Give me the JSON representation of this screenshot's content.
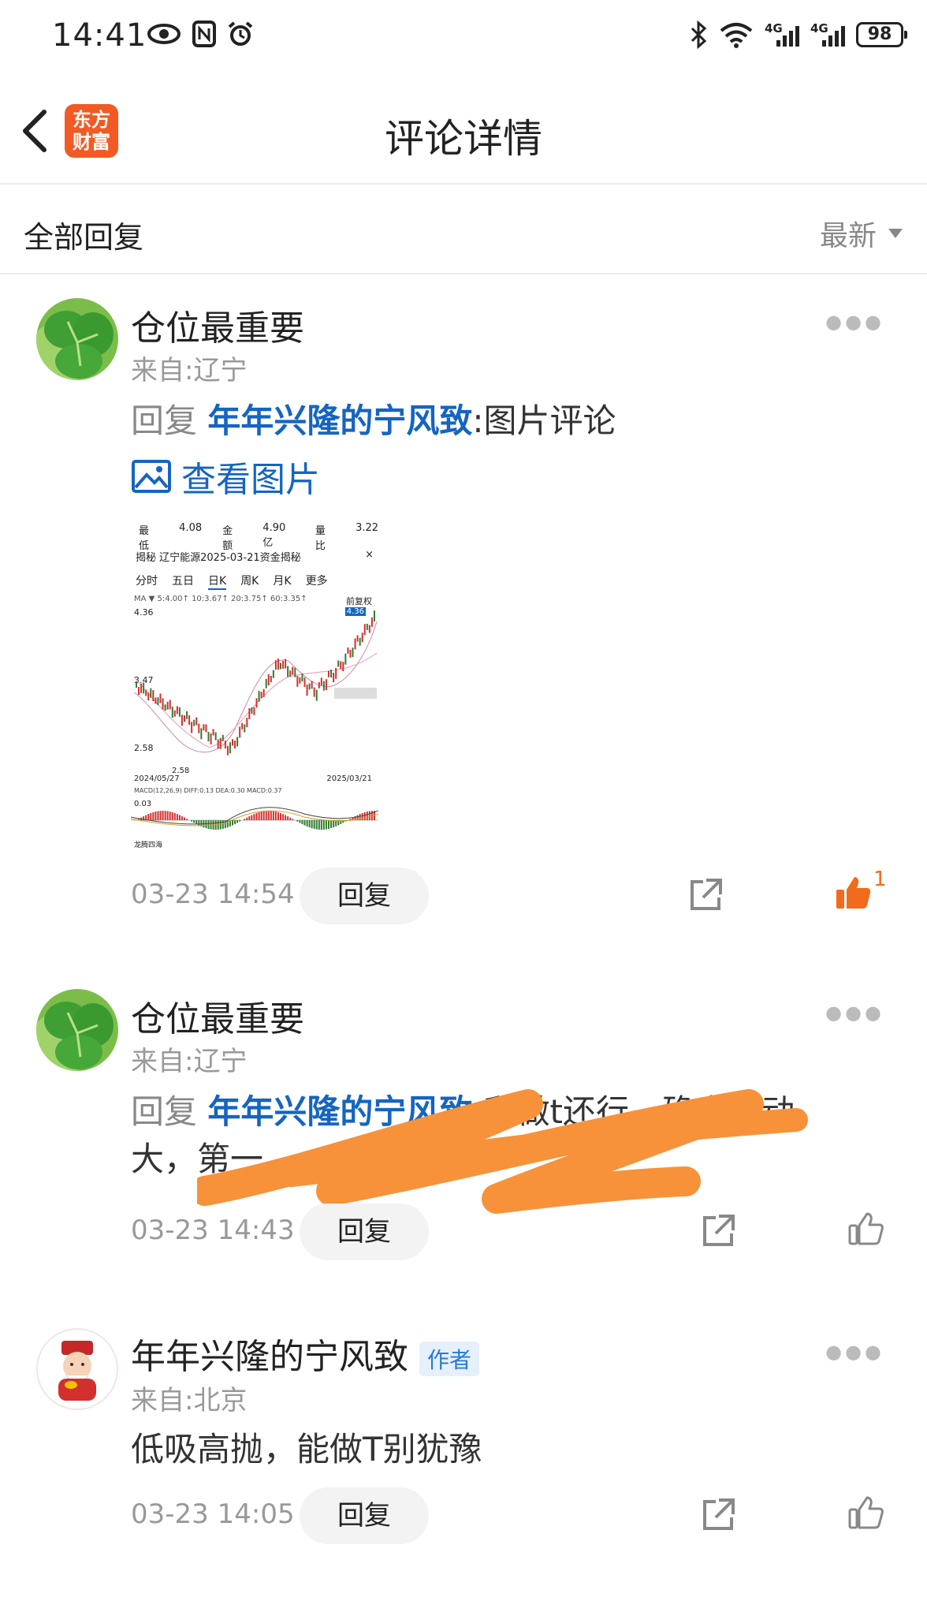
{
  "status_bar": {
    "time": "14:41",
    "battery": "98",
    "network_label": "4G",
    "icons": [
      "eye-icon",
      "nfc-icon",
      "alarm-icon",
      "bluetooth-icon",
      "wifi-icon",
      "signal-icon",
      "signal-icon",
      "battery-icon"
    ]
  },
  "header": {
    "title": "评论详情",
    "logo_line1": "东方",
    "logo_line2": "财富"
  },
  "subheader": {
    "label": "全部回复",
    "sort_label": "最新"
  },
  "comments": [
    {
      "username": "仓位最重要",
      "location": "来自:辽宁",
      "reply_prefix": "回复",
      "reply_to": "年年兴隆的宁风致",
      "text": ":图片评论",
      "view_image_label": "查看图片",
      "time": "03-23 14:54",
      "reply_button": "回复",
      "like_count": "1",
      "liked": true
    },
    {
      "username": "仓位最重要",
      "location": "来自:辽宁",
      "reply_prefix": "回复",
      "reply_to": "年年兴隆的宁风致",
      "text": ":我做t还行，确实波动",
      "text_line2": "大，第一",
      "time": "03-23 14:43",
      "reply_button": "回复",
      "liked": false
    },
    {
      "username": "年年兴隆的宁风致",
      "badge": "作者",
      "location": "来自:北京",
      "text": "低吸高抛，能做T别犹豫",
      "time": "03-23 14:05",
      "reply_button": "回复",
      "liked": false
    }
  ],
  "thumbnail": {
    "row1": [
      "最低",
      "4.08",
      "金额",
      "4.90亿",
      "量比",
      "3.22"
    ],
    "title": "揭秘  辽宁能源2025-03-21资金揭秘",
    "tabs": [
      "分时",
      "五日",
      "日K",
      "周K",
      "月K",
      "更多"
    ],
    "active_tab": "日K",
    "ma_label": "MA ▼ 5:4.00↑ 10:3.67↑ 20:3.75↑ 60:3.35↑",
    "fq_label": "前复权",
    "price_labels": [
      "4.36",
      "3.47",
      "2.58"
    ],
    "date_start": "2024/05/27",
    "date_end": "2025/03/21",
    "macd_label": "MACD(12,26,9)  DIFF:0.13  DEA:0.30  MACD:0.37",
    "macd_value": "0.03",
    "footer_label": "龙腾四海",
    "low_marker": "2.58",
    "high_marker": "4.36"
  },
  "colors": {
    "accent_orange": "#f15a24",
    "link_blue": "#1565c0",
    "like_orange": "#f26b1d",
    "scribble": "#f7923a"
  }
}
